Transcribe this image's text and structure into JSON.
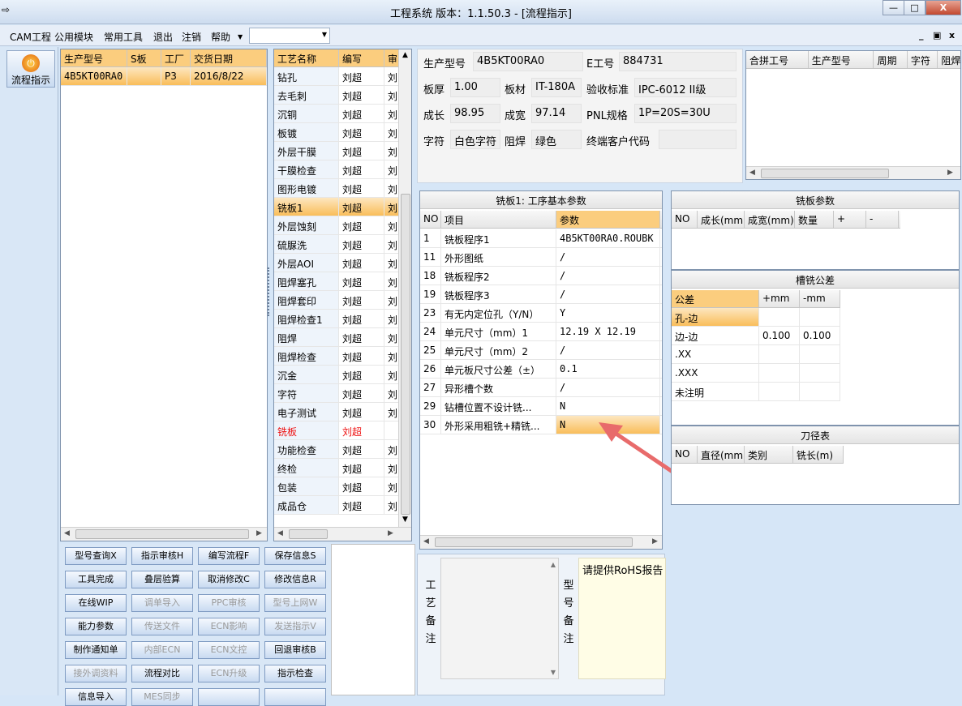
{
  "window": {
    "title": "工程系统  版本：1.1.50.3 - [流程指示]",
    "min": "—",
    "max": "□",
    "close": "X"
  },
  "menu": {
    "items": [
      "CAM工程",
      "公用模块",
      "常用工具",
      "退出",
      "注销",
      "帮助"
    ],
    "mdi": [
      "_",
      "▣",
      "x"
    ]
  },
  "left": {
    "flow_button": "流程指示"
  },
  "order_grid": {
    "headers": [
      "生产型号",
      "S板",
      "工厂",
      "交货日期"
    ],
    "rows": [
      [
        "4B5KT00RA0",
        "",
        "P3",
        "2016/8/22"
      ]
    ]
  },
  "process_grid": {
    "headers": [
      "工艺名称",
      "编写",
      "审"
    ],
    "rows": [
      [
        "钻孔",
        "刘超",
        "刘"
      ],
      [
        "去毛刺",
        "刘超",
        "刘"
      ],
      [
        "沉铜",
        "刘超",
        "刘"
      ],
      [
        "板镀",
        "刘超",
        "刘"
      ],
      [
        "外层干膜",
        "刘超",
        "刘"
      ],
      [
        "干膜检查",
        "刘超",
        "刘"
      ],
      [
        "图形电镀",
        "刘超",
        "刘"
      ],
      [
        "铣板1",
        "刘超",
        "刘"
      ],
      [
        "外层蚀刻",
        "刘超",
        "刘"
      ],
      [
        "硫脲洗",
        "刘超",
        "刘"
      ],
      [
        "外层AOI",
        "刘超",
        "刘"
      ],
      [
        "阻焊塞孔",
        "刘超",
        "刘"
      ],
      [
        "阻焊套印",
        "刘超",
        "刘"
      ],
      [
        "阻焊检查1",
        "刘超",
        "刘"
      ],
      [
        "阻焊",
        "刘超",
        "刘"
      ],
      [
        "阻焊检查",
        "刘超",
        "刘"
      ],
      [
        "沉金",
        "刘超",
        "刘"
      ],
      [
        "字符",
        "刘超",
        "刘"
      ],
      [
        "电子测试",
        "刘超",
        "刘"
      ],
      [
        "铣板",
        "刘超",
        ""
      ],
      [
        "功能检查",
        "刘超",
        "刘"
      ],
      [
        "终检",
        "刘超",
        "刘"
      ],
      [
        "包装",
        "刘超",
        "刘"
      ],
      [
        "成品仓",
        "刘超",
        "刘"
      ]
    ],
    "selected_index": 7,
    "red_index": 19
  },
  "info": {
    "prod_model_l": "生产型号",
    "prod_model": "4B5KT00RA0",
    "eng_no_l": "E工号",
    "eng_no": "884731",
    "thick_l": "板厚",
    "thick": "1.00",
    "material_l": "板材",
    "material": "IT-180A",
    "std_l": "验收标准",
    "std": "IPC-6012 II级",
    "len_l": "成长",
    "len": "98.95",
    "wid_l": "成宽",
    "wid": "97.14",
    "pnl_l": "PNL规格",
    "pnl": "1P=20S=30U",
    "char_l": "字符",
    "char": "白色字符",
    "mask_l": "阻焊",
    "mask": "绿色",
    "cust_l": "终端客户代码",
    "cust": ""
  },
  "merge_grid": {
    "headers": [
      "合拼工号",
      "生产型号",
      "周期",
      "字符",
      "阻焊"
    ]
  },
  "params": {
    "title": "铣板1: 工序基本参数",
    "headers": [
      "NO",
      "项目",
      "参数"
    ],
    "rows": [
      [
        "1",
        "铣板程序1",
        "4B5KT00RA0.ROUBK"
      ],
      [
        "11",
        "外形图纸",
        "/"
      ],
      [
        "18",
        "铣板程序2",
        "/"
      ],
      [
        "19",
        "铣板程序3",
        "/"
      ],
      [
        "23",
        "有无内定位孔（Y/N）",
        "Y"
      ],
      [
        "24",
        "单元尺寸（mm）1",
        "12.19 X 12.19"
      ],
      [
        "25",
        "单元尺寸（mm）2",
        "/"
      ],
      [
        "26",
        "单元板尺寸公差（±）",
        "0.1"
      ],
      [
        "27",
        "异形槽个数",
        "/"
      ],
      [
        "29",
        "钻槽位置不设计铣...",
        "N"
      ],
      [
        "30",
        "外形采用粗铣+精铣...",
        "N"
      ]
    ]
  },
  "mill_params": {
    "title": "铣板参数",
    "headers": [
      "NO",
      "成长(mm)",
      "成宽(mm)",
      "数量",
      "+",
      "-"
    ]
  },
  "slot_tol": {
    "title": "槽铣公差",
    "headers": [
      "公差",
      "+mm",
      "-mm"
    ],
    "rows": [
      [
        "孔-边",
        "",
        ""
      ],
      [
        "边-边",
        "0.100",
        "0.100"
      ],
      [
        ".XX",
        "",
        ""
      ],
      [
        ".XXX",
        "",
        ""
      ],
      [
        "未注明",
        "",
        ""
      ]
    ]
  },
  "tool_table": {
    "title": "刀径表",
    "headers": [
      "NO",
      "直径(mm)",
      "类别",
      "铣长(m)"
    ]
  },
  "memo": {
    "proc_label": "工艺备注",
    "model_label": "型号备注",
    "model_text": "请提供RoHS报告"
  },
  "buttons": [
    [
      "型号查询X",
      "指示审核H",
      "编写流程F",
      "保存信息S"
    ],
    [
      "工具完成",
      "叠层验算",
      "取消修改C",
      "修改信息R"
    ],
    [
      "在线WIP",
      "调单导入",
      "PPC审核",
      "型号上网W"
    ],
    [
      "能力参数",
      "传送文件",
      "ECN影响",
      "发送指示V"
    ],
    [
      "制作通知单",
      "内部ECN",
      "ECN文控",
      "回退审核B"
    ],
    [
      "接外调资料",
      "流程对比",
      "ECN升级",
      "指示检查"
    ],
    [
      "信息导入",
      "MES同步",
      "",
      ""
    ]
  ],
  "disabled_buttons": [
    [
      2,
      1
    ],
    [
      2,
      2
    ],
    [
      2,
      3
    ],
    [
      3,
      1
    ],
    [
      3,
      2
    ],
    [
      3,
      3
    ],
    [
      4,
      1
    ],
    [
      4,
      2
    ],
    [
      5,
      0
    ],
    [
      5,
      2
    ],
    [
      6,
      1
    ]
  ]
}
